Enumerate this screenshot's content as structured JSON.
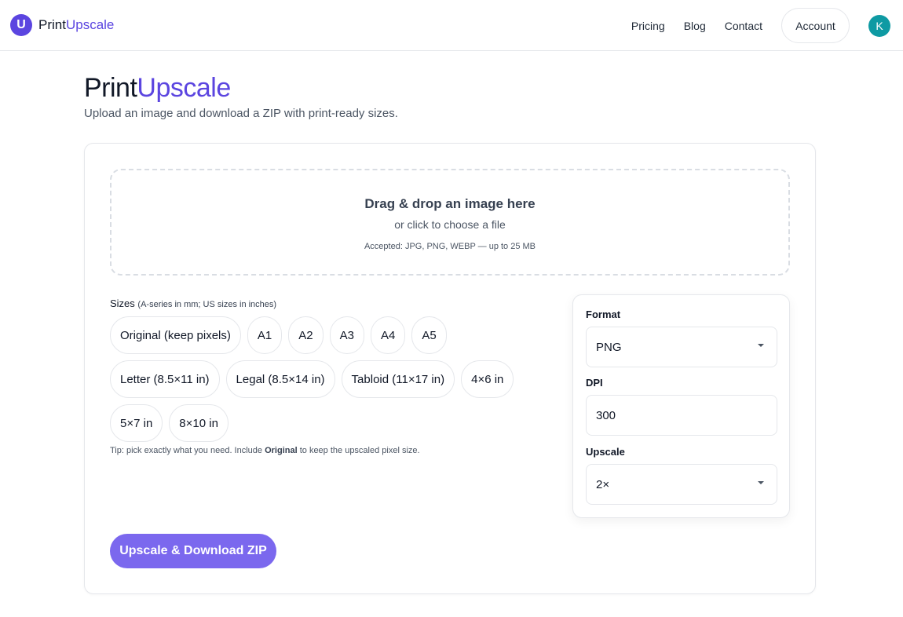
{
  "brand": {
    "logo_letter": "U",
    "name_part1": "Print",
    "name_part2": "Upscale"
  },
  "nav": {
    "links": [
      "Pricing",
      "Blog",
      "Contact"
    ],
    "account_label": "Account",
    "avatar_initial": "K"
  },
  "hero": {
    "title_part1": "Print",
    "title_part2": "Upscale",
    "subtitle": "Upload an image and download a ZIP with print-ready sizes."
  },
  "dropzone": {
    "title": "Drag & drop an image here",
    "subtitle": "or click to choose a file",
    "accepted": "Accepted: JPG, PNG, WEBP — up to 25 MB"
  },
  "sizes": {
    "label": "Sizes",
    "hint": "(A-series in mm; US sizes in inches)",
    "rows": [
      [
        "Original (keep pixels)",
        "A1",
        "A2",
        "A3",
        "A4",
        "A5"
      ],
      [
        "Letter (8.5×11 in)",
        "Legal (8.5×14 in)",
        "Tabloid (11×17 in)",
        "4×6 in"
      ],
      [
        "5×7 in",
        "8×10 in"
      ]
    ],
    "tip_prefix": "Tip: pick exactly what you need. Include ",
    "tip_bold": "Original",
    "tip_suffix": " to keep the upscaled pixel size."
  },
  "settings": {
    "format_label": "Format",
    "format_value": "PNG",
    "dpi_label": "DPI",
    "dpi_value": "300",
    "upscale_label": "Upscale",
    "upscale_value": "2×"
  },
  "cta_label": "Upscale & Download ZIP",
  "colors": {
    "accent": "#5b45e0",
    "button": "#7b68ee",
    "avatar": "#0e9aa3"
  }
}
